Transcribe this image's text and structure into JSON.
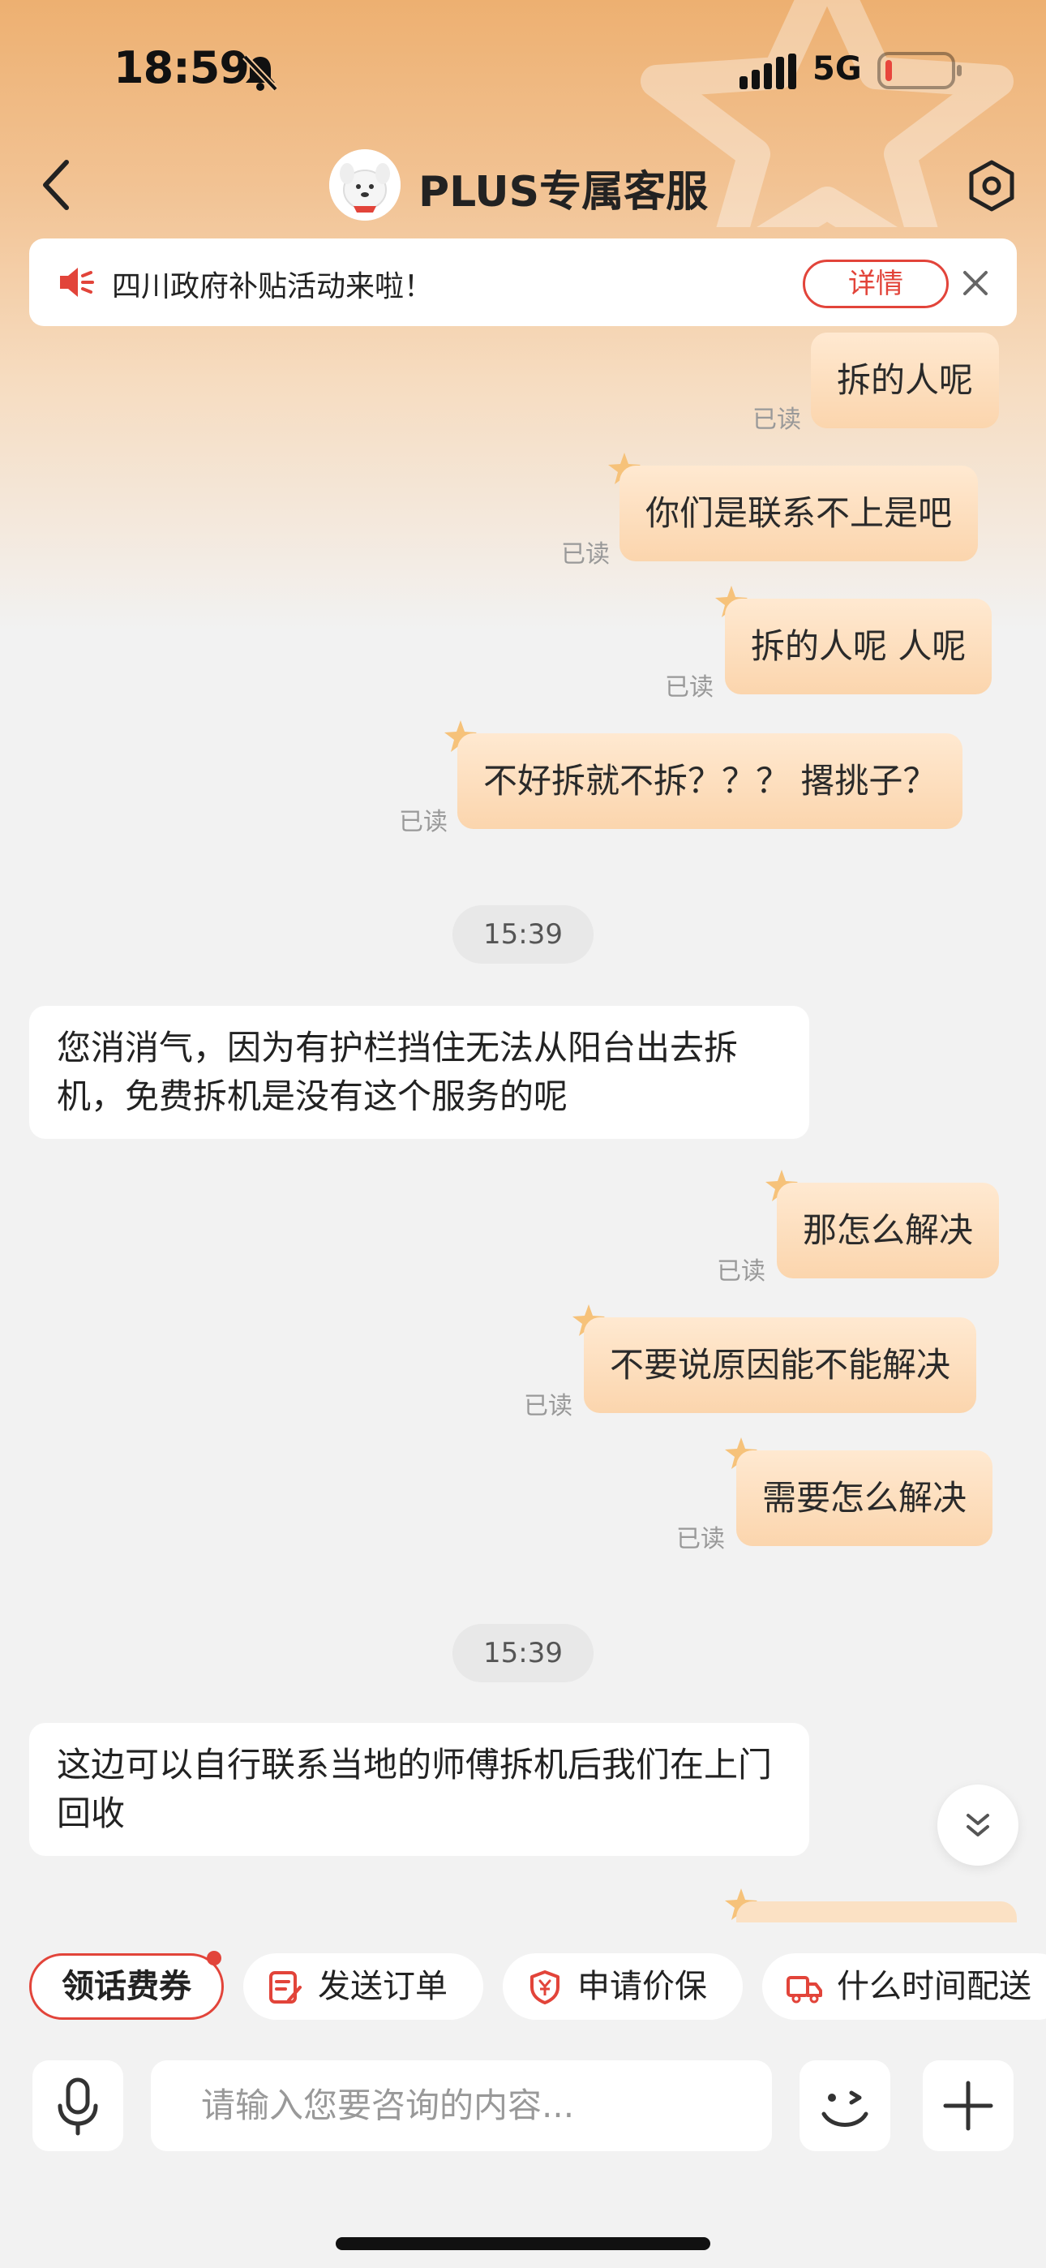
{
  "status_bar": {
    "time": "18:59",
    "network": "5G",
    "battery_level": 0.1
  },
  "header": {
    "title": "PLUS专属客服"
  },
  "notice": {
    "text": "四川政府补贴活动来啦！",
    "detail_label": "详情"
  },
  "messages": [
    {
      "type": "out",
      "text": "拆的人呢",
      "read": "已读"
    },
    {
      "type": "out",
      "text": "你们是联系不上是吧",
      "read": "已读"
    },
    {
      "type": "out",
      "text": "拆的人呢 人呢",
      "read": "已读"
    },
    {
      "type": "out",
      "text": "不好拆就不拆？？？ 撂挑子？",
      "read": "已读"
    },
    {
      "type": "time",
      "text": "15:39"
    },
    {
      "type": "in",
      "text": "您消消气，因为有护栏挡住无法从阳台出去拆机，免费拆机是没有这个服务的呢"
    },
    {
      "type": "out",
      "text": "那怎么解决",
      "read": "已读"
    },
    {
      "type": "out",
      "text": "不要说原因能不能解决",
      "read": "已读"
    },
    {
      "type": "out",
      "text": "需要怎么解决",
      "read": "已读"
    },
    {
      "type": "time",
      "text": "15:39"
    },
    {
      "type": "in",
      "text": "这边可以自行联系当地的师傅拆机后我们在上门回收"
    }
  ],
  "quick_actions": [
    {
      "label": "领话费券",
      "icon": ""
    },
    {
      "label": "发送订单",
      "icon": "order-icon"
    },
    {
      "label": "申请价保",
      "icon": "shield-yen-icon"
    },
    {
      "label": "什么时间配送",
      "icon": "truck-icon"
    }
  ],
  "input": {
    "placeholder": "请输入您要咨询的内容..."
  },
  "colors": {
    "accent": "#e2443a",
    "bubble_out": "#fbd5ad",
    "header_top": "#edb071"
  }
}
